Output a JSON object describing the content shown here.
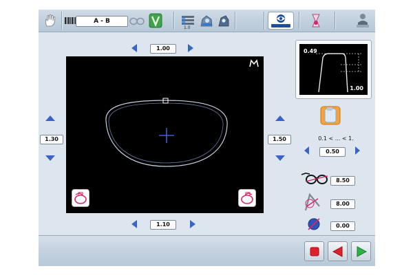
{
  "toolbar": {
    "lens_selector": "A - B",
    "tray_count": "1.0"
  },
  "screen": {
    "top_value": "1.00",
    "bottom_value": "1.10",
    "left_value": "1.30",
    "right_value": "1.50"
  },
  "graph": {
    "value_top": "0.49",
    "value_bottom": "1.00"
  },
  "range": {
    "label": "0.1 < ... < 1.",
    "value": "0.50"
  },
  "params": {
    "frame_value": "8.50",
    "angle_value": "8.00",
    "diameter_value": "0.00"
  },
  "colors": {
    "record": "#e0202a",
    "back": "#e0202a",
    "next": "#2db34a",
    "arrow": "#3a63c8",
    "accent": "#d6266a"
  }
}
